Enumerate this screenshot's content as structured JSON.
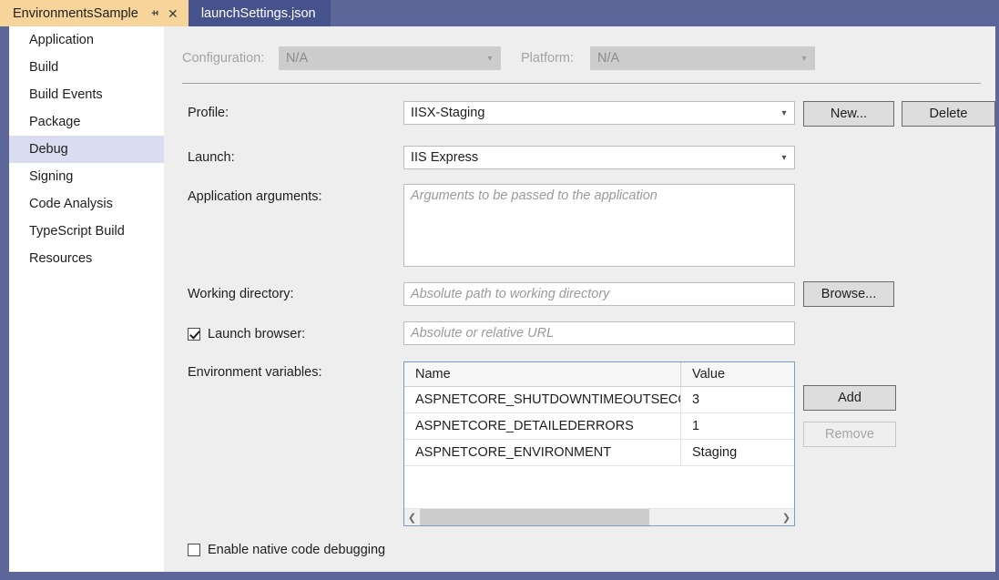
{
  "tabs": [
    {
      "label": "EnvironmentsSample",
      "active": true,
      "pin_icon": "pin-icon",
      "close_icon": "close-icon"
    },
    {
      "label": "launchSettings.json",
      "active": false
    }
  ],
  "sidebar": {
    "items": [
      {
        "label": "Application",
        "selected": false
      },
      {
        "label": "Build",
        "selected": false
      },
      {
        "label": "Build Events",
        "selected": false
      },
      {
        "label": "Package",
        "selected": false
      },
      {
        "label": "Debug",
        "selected": true
      },
      {
        "label": "Signing",
        "selected": false
      },
      {
        "label": "Code Analysis",
        "selected": false
      },
      {
        "label": "TypeScript Build",
        "selected": false
      },
      {
        "label": "Resources",
        "selected": false
      }
    ]
  },
  "header": {
    "configuration_label": "Configuration:",
    "configuration_value": "N/A",
    "platform_label": "Platform:",
    "platform_value": "N/A"
  },
  "form": {
    "profile_label": "Profile:",
    "profile_value": "IISX-Staging",
    "new_button": "New...",
    "delete_button": "Delete",
    "launch_label": "Launch:",
    "launch_value": "IIS Express",
    "app_args_label": "Application arguments:",
    "app_args_placeholder": "Arguments to be passed to the application",
    "working_dir_label": "Working directory:",
    "working_dir_placeholder": "Absolute path to working directory",
    "browse_button": "Browse...",
    "launch_browser_label": "Launch browser:",
    "launch_browser_checked": true,
    "launch_browser_placeholder": "Absolute or relative URL",
    "env_vars_label": "Environment variables:",
    "add_button": "Add",
    "remove_button": "Remove",
    "native_debug_label": "Enable native code debugging",
    "native_debug_checked": false
  },
  "env_grid": {
    "columns": [
      "Name",
      "Value"
    ],
    "rows": [
      {
        "name": "ASPNETCORE_SHUTDOWNTIMEOUTSECONDS",
        "value": "3"
      },
      {
        "name": "ASPNETCORE_DETAILEDERRORS",
        "value": "1"
      },
      {
        "name": "ASPNETCORE_ENVIRONMENT",
        "value": "Staging"
      }
    ],
    "scroll_left_icon": "chevron-left-icon",
    "scroll_right_icon": "chevron-right-icon"
  },
  "colors": {
    "frame": "#5c6699",
    "active_tab": "#f6d49a",
    "inactive_tab": "#46528c",
    "selection": "#dadcf2",
    "panel": "#eeeeee"
  }
}
